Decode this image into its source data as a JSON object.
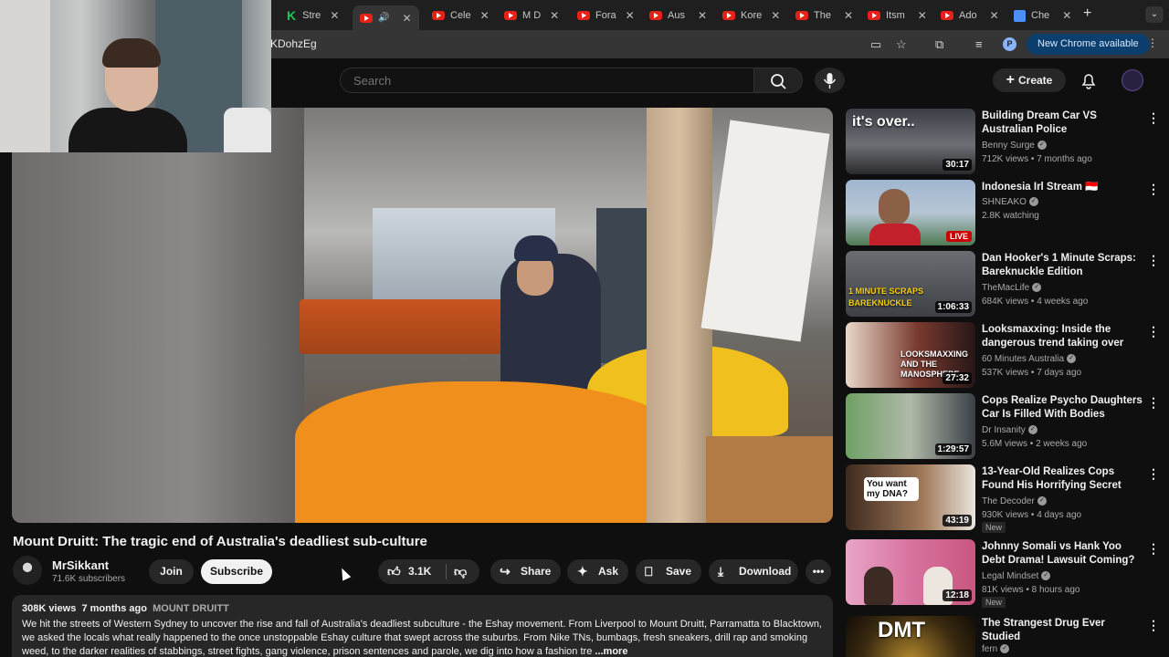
{
  "browser": {
    "tabs": [
      {
        "label": "Stre",
        "favicon": "kick-icon"
      },
      {
        "label": "",
        "favicon": "youtube-icon",
        "active": true
      },
      {
        "label": "Cele",
        "favicon": "youtube-icon"
      },
      {
        "label": "M D",
        "favicon": "youtube-icon"
      },
      {
        "label": "Fora",
        "favicon": "youtube-icon"
      },
      {
        "label": "Aus",
        "favicon": "youtube-icon"
      },
      {
        "label": "Kore",
        "favicon": "youtube-icon"
      },
      {
        "label": "The",
        "favicon": "youtube-icon"
      },
      {
        "label": "Itsm",
        "favicon": "youtube-icon"
      },
      {
        "label": "Ado",
        "favicon": "youtube-icon"
      },
      {
        "label": "Che",
        "favicon": "docs-icon"
      }
    ],
    "url_fragment": "KDohzEg",
    "profile_initial": "P",
    "update_label": "New Chrome available"
  },
  "header": {
    "search_placeholder": "Search",
    "create_label": "Create"
  },
  "video": {
    "title": "Mount Druitt: The tragic end of Australia's deadliest sub-culture",
    "channel": "MrSikkant",
    "subscribers": "71.6K subscribers",
    "join_label": "Join",
    "subscribe_label": "Subscribe",
    "likes": "3.1K",
    "share_label": "Share",
    "ask_label": "Ask",
    "save_label": "Save",
    "download_label": "Download"
  },
  "description": {
    "views": "308K views",
    "age": "7 months ago",
    "tag": "MOUNT DRUITT",
    "text": "We hit the streets of Western Sydney to uncover the rise and fall of Australia's deadliest subculture - the Eshay movement. From Liverpool to Mount Druitt, Parramatta to Blacktown, we asked the locals what really happened to the once unstoppable Eshay culture that swept across the suburbs. From Nike TNs, bumbags, fresh sneakers, drill rap and smoking weed, to the darker realities of stabbings, street fights, gang violence, prison sentences and parole, we dig into how a fashion tre",
    "more_label": "...more"
  },
  "recommendations": [
    {
      "title": "Building Dream Car VS Australian Police",
      "channel": "Benny Surge",
      "verified": true,
      "stats": "712K views • 7 months ago",
      "duration": "30:17",
      "caption": "it's over..",
      "new": ""
    },
    {
      "title": "Indonesia Irl Stream 🇮🇩",
      "channel": "SHNEAKO",
      "verified": true,
      "stats": "2.8K watching",
      "duration": "LIVE",
      "caption": "",
      "new": ""
    },
    {
      "title": "Dan Hooker's 1 Minute Scraps: Bareknuckle Edition",
      "channel": "TheMacLife",
      "verified": true,
      "stats": "684K views • 4 weeks ago",
      "duration": "1:06:33",
      "caption": "1 MINUTE SCRAPS BAREKNUCKLE",
      "new": ""
    },
    {
      "title": "Looksmaxxing: Inside the dangerous trend taking over the...",
      "channel": "60 Minutes Australia",
      "verified": true,
      "stats": "537K views • 7 days ago",
      "duration": "27:32",
      "caption": "LOOKSMAXXING AND THE MANOSPHERE",
      "new": ""
    },
    {
      "title": "Cops Realize Psycho Daughters Car Is Filled With Bodies",
      "channel": "Dr Insanity",
      "verified": true,
      "stats": "5.6M views • 2 weeks ago",
      "duration": "1:29:57",
      "caption": "",
      "new": ""
    },
    {
      "title": "13-Year-Old Realizes Cops Found His Horrifying Secret",
      "channel": "The Decoder",
      "verified": true,
      "stats": "930K views • 4 days ago",
      "duration": "43:19",
      "caption": "You want my DNA?",
      "new": "New"
    },
    {
      "title": "Johnny Somali vs Hank Yoo Debt Drama! Lawsuit Coming?",
      "channel": "Legal Mindset",
      "verified": true,
      "stats": "81K views • 8 hours ago",
      "duration": "12:18",
      "caption": "",
      "new": "New"
    },
    {
      "title": "The Strangest Drug Ever Studied",
      "channel": "fern",
      "verified": true,
      "stats": "",
      "duration": "",
      "caption": "DMT",
      "new": ""
    }
  ],
  "colors": {
    "background": "#0f0f0f",
    "live_badge": "#cc0000",
    "subscribe_bg": "#f1f1f1",
    "update_button": "#0c3f6e"
  }
}
